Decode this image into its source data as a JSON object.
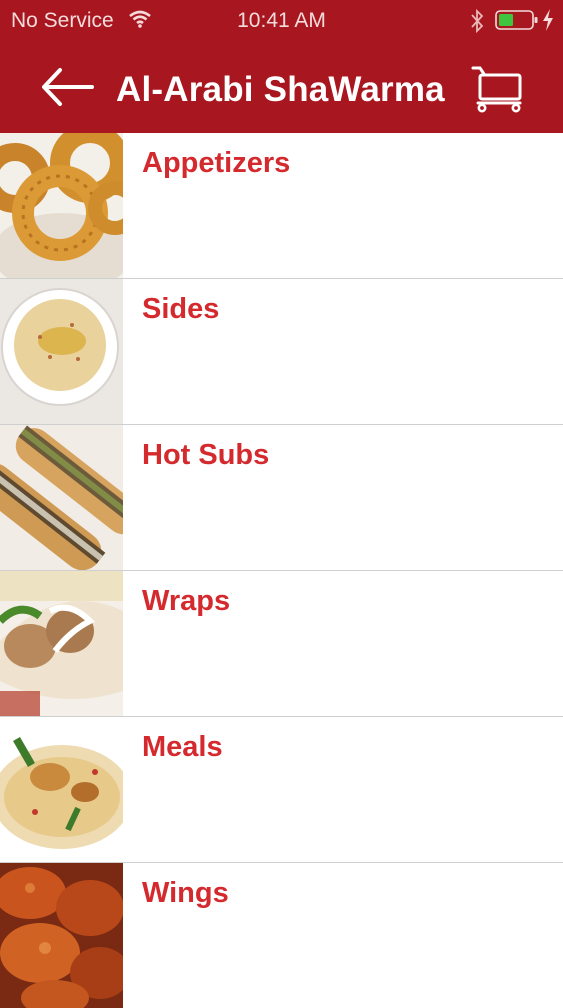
{
  "status_bar": {
    "carrier": "No Service",
    "time": "10:41 AM",
    "icons": [
      "wifi-icon",
      "bluetooth-icon",
      "battery-icon",
      "charging-bolt-icon"
    ]
  },
  "nav": {
    "title": "Al-Arabi ShaWarma",
    "back_icon": "back-arrow-icon",
    "cart_icon": "cart-icon"
  },
  "theme": {
    "header_color": "#a8161f",
    "label_color": "#d42a2e",
    "battery_color": "#3ec43e"
  },
  "categories": [
    {
      "label": "Appetizers",
      "image": "onion-rings-photo"
    },
    {
      "label": "Sides",
      "image": "hummus-photo"
    },
    {
      "label": "Hot Subs",
      "image": "sub-sandwich-photo"
    },
    {
      "label": "Wraps",
      "image": "wrap-photo"
    },
    {
      "label": "Meals",
      "image": "rice-chicken-photo"
    },
    {
      "label": "Wings",
      "image": "chicken-wings-photo"
    }
  ]
}
